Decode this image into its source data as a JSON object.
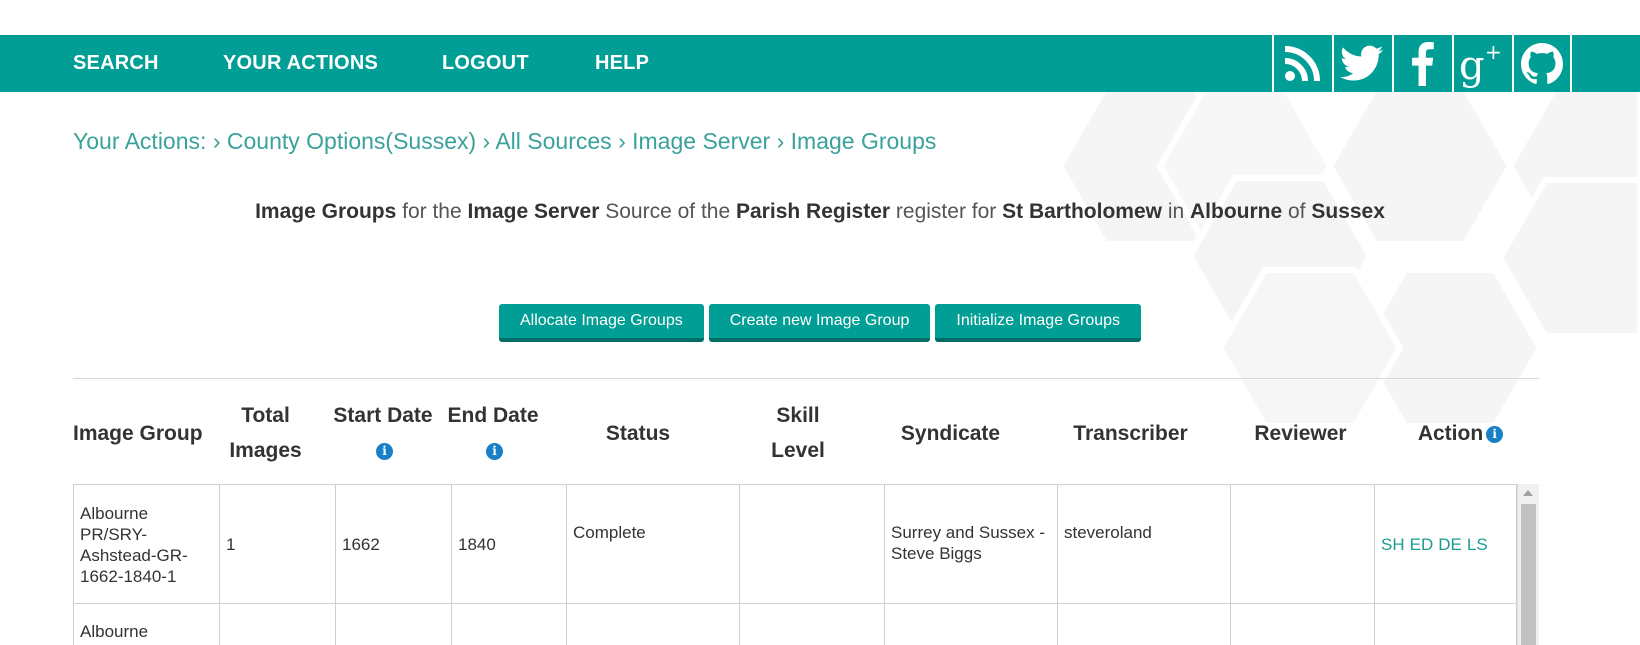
{
  "nav": {
    "items": [
      "SEARCH",
      "YOUR ACTIONS",
      "LOGOUT",
      "HELP"
    ],
    "social_icons": [
      "rss-icon",
      "twitter-icon",
      "facebook-icon",
      "google-plus-icon",
      "github-icon"
    ]
  },
  "breadcrumb": {
    "root": "Your Actions:",
    "items": [
      "County Options(Sussex)",
      "All Sources",
      "Image Server",
      "Image Groups"
    ],
    "separator": "›"
  },
  "heading": {
    "parts": [
      "Image Groups",
      " for the ",
      "Image Server",
      " Source of the ",
      "Parish Register",
      " register for ",
      "St Bartholomew",
      " in ",
      "Albourne",
      " of ",
      "Sussex"
    ]
  },
  "buttons": {
    "allocate": "Allocate Image Groups",
    "create": "Create new Image Group",
    "initialize": "Initialize Image Groups"
  },
  "table": {
    "headers": [
      "Image Group",
      "Total Images",
      "Start Date",
      "End Date",
      "Status",
      "Skill Level",
      "Syndicate",
      "Transcriber",
      "Reviewer",
      "Action"
    ],
    "rows": [
      {
        "image_group": "Albourne PR/SRY-Ashstead-GR-1662-1840-1",
        "total_images": "1",
        "start_date": "1662",
        "end_date": "1840",
        "status": "Complete",
        "skill_level": "",
        "syndicate": "Surrey and Sussex - Steve Biggs",
        "transcriber": "steveroland",
        "reviewer": "",
        "actions": [
          "SH",
          "ED",
          "DE",
          "LS"
        ]
      },
      {
        "image_group": "Albourne"
      }
    ]
  },
  "colors": {
    "brand": "#009e94",
    "link": "#3aa19b",
    "info": "#1a80c6"
  }
}
